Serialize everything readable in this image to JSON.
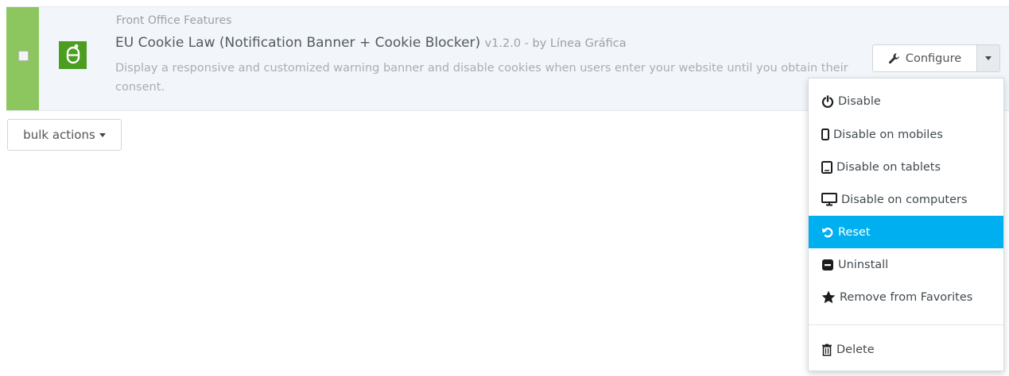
{
  "module": {
    "category": "Front Office Features",
    "name": "EU Cookie Law (Notification Banner + Cookie Blocker)",
    "meta": "v1.2.0 - by Línea Gráfica",
    "description": "Display a responsive and customized warning banner and disable cookies when users enter your website until you obtain their consent.",
    "status_color": "#8dc65e",
    "logo_color": "#4c9e21",
    "logo_icon": "cookie-logo-icon"
  },
  "configure": {
    "label": "Configure",
    "icon": "wrench-icon"
  },
  "bulk": {
    "label": "bulk actions"
  },
  "menu": {
    "highlight_color": "#00aff0",
    "items": [
      {
        "label": "Disable",
        "icon": "power-icon"
      },
      {
        "label": "Disable on mobiles",
        "icon": "mobile-icon"
      },
      {
        "label": "Disable on tablets",
        "icon": "tablet-icon"
      },
      {
        "label": "Disable on computers",
        "icon": "desktop-icon"
      },
      {
        "label": "Reset",
        "icon": "undo-icon",
        "active": true
      },
      {
        "label": "Uninstall",
        "icon": "minus-icon"
      },
      {
        "label": "Remove from Favorites",
        "icon": "star-icon"
      },
      {
        "label": "Delete",
        "icon": "trash-icon"
      }
    ]
  }
}
